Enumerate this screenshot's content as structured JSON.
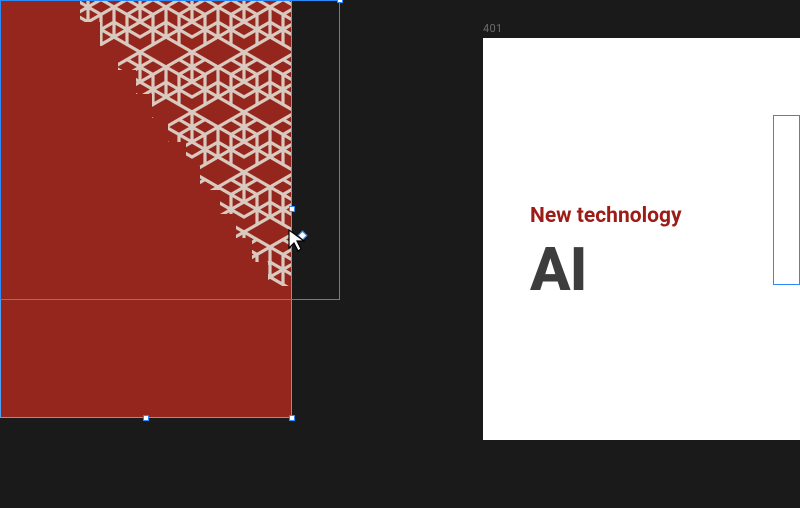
{
  "canvas": {
    "background_color": "#1a1a1a"
  },
  "artboard_left": {
    "fill_color": "#94261d",
    "pattern_stroke": "#d9c9be"
  },
  "artboard_right": {
    "label": "401",
    "subtitle": "New technology",
    "title": "AI",
    "subtitle_color": "#9c1d18",
    "title_color": "#3d3d3d",
    "background": "#ffffff"
  },
  "selection": {
    "border_color": "#2b8af7"
  }
}
